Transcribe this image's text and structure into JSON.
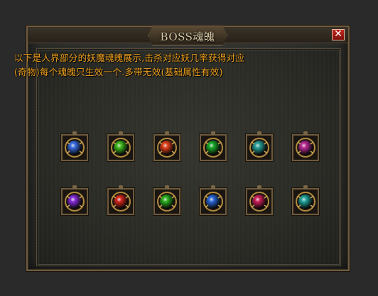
{
  "window": {
    "title": "BOSS魂魄",
    "close_label": "✕"
  },
  "description": {
    "line1": "以下是人界部分的妖魔魂魄展示,击杀对应妖几率获得对应",
    "line2": "(奇物)每个魂魄只生效一个.多带无效(基础属性有效)"
  },
  "souls": [
    {
      "icon": "blue-diamond-amulet-icon",
      "color": "#3a6fe8"
    },
    {
      "icon": "green-orb-icon",
      "color": "#3fc01c"
    },
    {
      "icon": "orange-red-orb-icon",
      "color": "#e8431b"
    },
    {
      "icon": "emerald-orb-icon",
      "color": "#19b02a"
    },
    {
      "icon": "teal-spiked-orb-icon",
      "color": "#28a39a"
    },
    {
      "icon": "magenta-orb-icon",
      "color": "#c02c9a"
    },
    {
      "icon": "purple-orb-icon",
      "color": "#8a2ce0"
    },
    {
      "icon": "red-orb-icon",
      "color": "#d8281c"
    },
    {
      "icon": "green-gold-ring-orb-icon",
      "color": "#2bb51f"
    },
    {
      "icon": "blue-winged-orb-icon",
      "color": "#2a6adf"
    },
    {
      "icon": "crimson-orb-icon",
      "color": "#d01f5a"
    },
    {
      "icon": "teal-serpent-orb-icon",
      "color": "#1fa8a0"
    }
  ]
}
